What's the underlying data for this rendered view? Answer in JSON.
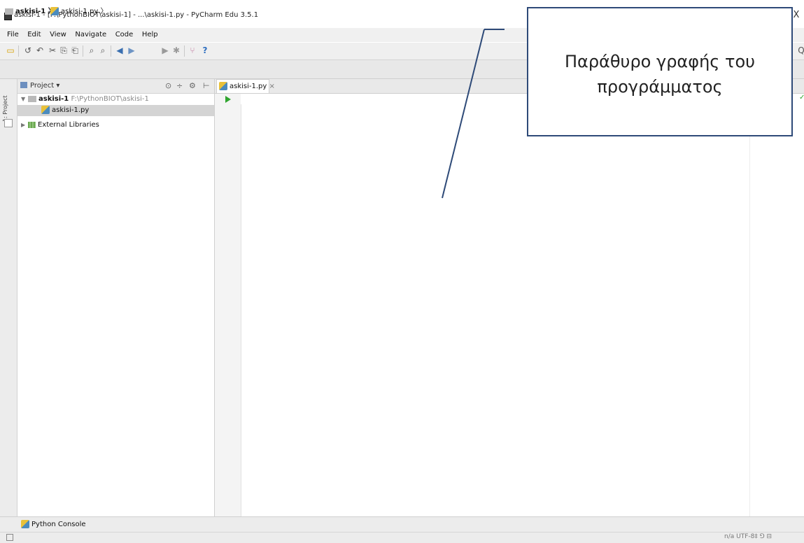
{
  "window": {
    "title": "askisi-1 - [F:\\PythonBIOT\\askisi-1] - ...\\askisi-1.py - PyCharm Edu 3.5.1",
    "minimize_glyph": "–",
    "maximize_glyph": "☐",
    "close_glyph": "X"
  },
  "menu": [
    "File",
    "Edit",
    "View",
    "Navigate",
    "Code",
    "Help"
  ],
  "toolbar": {
    "icons": [
      "open-folder-icon",
      "sync-icon",
      "undo-icon",
      "cut-icon",
      "copy-icon",
      "paste-icon",
      "find-icon",
      "replace-icon",
      "back-icon",
      "forward-icon",
      "run-config-icon",
      "run-icon",
      "debug-icon",
      "vcs-icon",
      "help-icon"
    ],
    "help_glyph": "?",
    "search_glyph": "Q"
  },
  "breadcrumb": {
    "project": "askisi-1",
    "file": "askisi-1.py"
  },
  "left_strip": {
    "label": "1: Project"
  },
  "project_panel": {
    "title": "Project",
    "dropdown_glyph": "▾",
    "root_name": "askisi-1",
    "root_path": "F:\\PythonBIOT\\askisi-1",
    "file": "askisi-1.py",
    "external": "External Libraries"
  },
  "editor": {
    "tab_label": "askisi-1.py",
    "tab_close": "×"
  },
  "bottom": {
    "console": "Python Console"
  },
  "status": {
    "right": "n/a  UTF-8‡  ⅁  ⊟"
  },
  "annotation": {
    "line1": "Παράθυρο γραφής του",
    "line2": "προγράμματος"
  },
  "colors": {
    "callout_border": "#2e4a78",
    "pointer_line": "#2e4a78",
    "run_marker": "#2fa52f"
  }
}
